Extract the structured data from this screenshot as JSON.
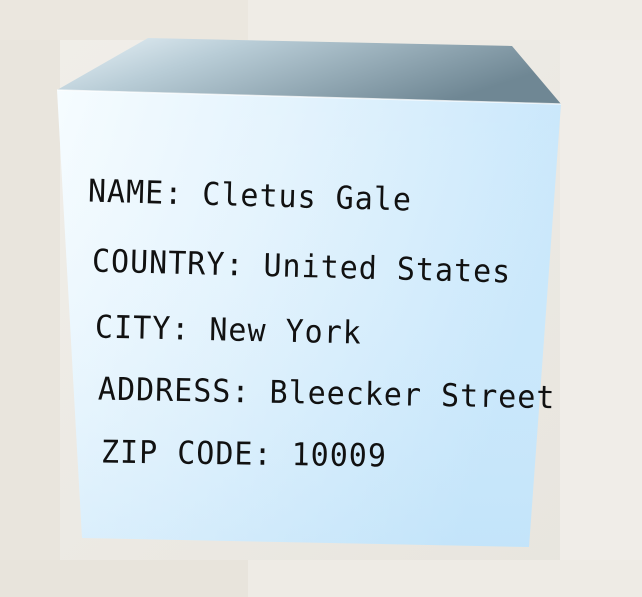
{
  "card": {
    "lines": [
      "NAME: Cletus Gale",
      "COUNTRY: United States",
      "CITY: New York",
      "ADDRESS: Bleecker Street",
      "ZIP CODE: 10009"
    ]
  },
  "colors": {
    "front_face_light": "#f4fbff",
    "front_face_blue": "#c9e7fb",
    "top_face_dark": "#7f96a2",
    "top_face_light": "#e6f0f5",
    "text": "#111111"
  }
}
